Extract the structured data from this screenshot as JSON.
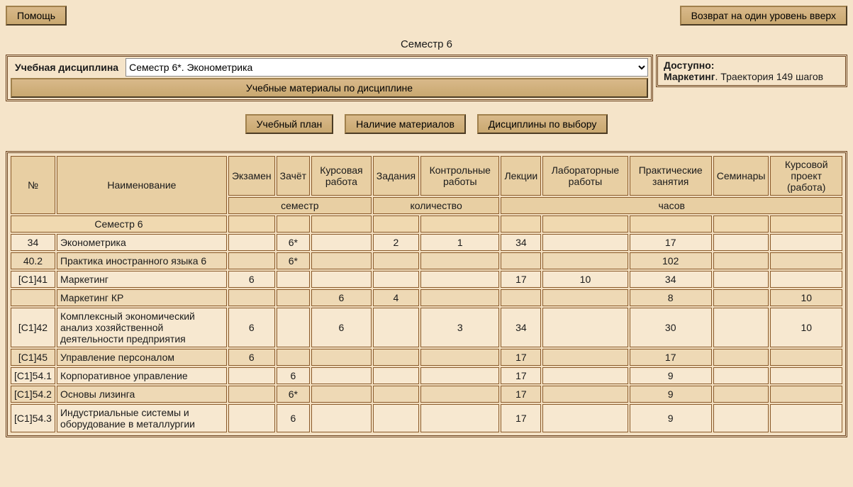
{
  "topbar": {
    "help_label": "Помощь",
    "back_label": "Возврат на один уровень вверх"
  },
  "semester_title": "Семестр 6",
  "discipline": {
    "label": "Учебная дисциплина",
    "selected": "Семестр 6*. Эконометрика",
    "materials_label": "Учебные материалы по дисциплине"
  },
  "available": {
    "title": "Доступно:",
    "subject": "Маркетинг",
    "detail": ". Траектория 149 шагов"
  },
  "center_buttons": {
    "plan_label": "Учебный план",
    "materials_label": "Наличие материалов",
    "elective_label": "Дисциплины по выбору"
  },
  "table": {
    "headers": {
      "num": "№",
      "name": "Наименование",
      "exam": "Экзамен",
      "pass": "Зачёт",
      "coursework": "Курсовая работа",
      "tasks": "Задания",
      "control": "Контрольные работы",
      "lectures": "Лекции",
      "lab": "Лабораторные работы",
      "practice": "Практические занятия",
      "seminars": "Семинары",
      "project": "Курсовой проект (работа)"
    },
    "bands": {
      "semester": "семестр",
      "count": "количество",
      "hours": "часов"
    },
    "group_label": "Семестр 6",
    "rows": [
      {
        "num": "34",
        "name": "Эконометрика",
        "exam": "",
        "pass": "6*",
        "cw": "",
        "tasks": "2",
        "ctrl": "1",
        "lec": "34",
        "lab": "",
        "pract": "17",
        "sem": "",
        "proj": ""
      },
      {
        "num": "40.2",
        "name": "Практика иностранного языка 6",
        "exam": "",
        "pass": "6*",
        "cw": "",
        "tasks": "",
        "ctrl": "",
        "lec": "",
        "lab": "",
        "pract": "102",
        "sem": "",
        "proj": ""
      },
      {
        "num": "[С1]41",
        "name": "Маркетинг",
        "exam": "6",
        "pass": "",
        "cw": "",
        "tasks": "",
        "ctrl": "",
        "lec": "17",
        "lab": "10",
        "pract": "34",
        "sem": "",
        "proj": ""
      },
      {
        "num": "",
        "name": "Маркетинг КР",
        "exam": "",
        "pass": "",
        "cw": "6",
        "tasks": "4",
        "ctrl": "",
        "lec": "",
        "lab": "",
        "pract": "8",
        "sem": "",
        "proj": "10"
      },
      {
        "num": "[С1]42",
        "name": "Комплексный экономический анализ хозяйственной деятельности предприятия",
        "exam": "6",
        "pass": "",
        "cw": "6",
        "tasks": "",
        "ctrl": "3",
        "lec": "34",
        "lab": "",
        "pract": "30",
        "sem": "",
        "proj": "10"
      },
      {
        "num": "[С1]45",
        "name": "Управление персоналом",
        "exam": "6",
        "pass": "",
        "cw": "",
        "tasks": "",
        "ctrl": "",
        "lec": "17",
        "lab": "",
        "pract": "17",
        "sem": "",
        "proj": ""
      },
      {
        "num": "[С1]54.1",
        "name": "Корпоративное управление",
        "exam": "",
        "pass": "6",
        "cw": "",
        "tasks": "",
        "ctrl": "",
        "lec": "17",
        "lab": "",
        "pract": "9",
        "sem": "",
        "proj": ""
      },
      {
        "num": "[С1]54.2",
        "name": "Основы лизинга",
        "exam": "",
        "pass": "6*",
        "cw": "",
        "tasks": "",
        "ctrl": "",
        "lec": "17",
        "lab": "",
        "pract": "9",
        "sem": "",
        "proj": ""
      },
      {
        "num": "[С1]54.3",
        "name": "Индустриальные системы и оборудование в металлургии",
        "exam": "",
        "pass": "6",
        "cw": "",
        "tasks": "",
        "ctrl": "",
        "lec": "17",
        "lab": "",
        "pract": "9",
        "sem": "",
        "proj": ""
      }
    ]
  }
}
